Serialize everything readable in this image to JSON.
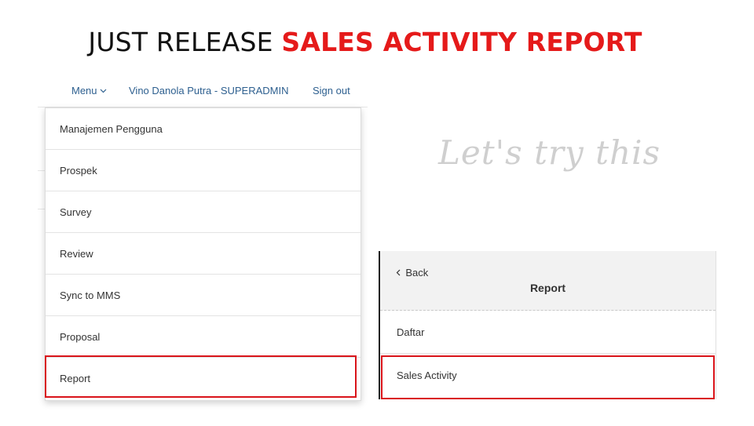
{
  "title": {
    "plain": "JUST RELEASE ",
    "accent": "SALES ACTIVITY REPORT"
  },
  "topnav": {
    "menu_label": "Menu",
    "user_label": "Vino Danola Putra - SUPERADMIN",
    "signout_label": "Sign out"
  },
  "dropdown": {
    "items": [
      {
        "label": "Manajemen Pengguna"
      },
      {
        "label": "Prospek"
      },
      {
        "label": "Survey"
      },
      {
        "label": "Review"
      },
      {
        "label": "Sync to MMS"
      },
      {
        "label": "Proposal"
      },
      {
        "label": "Report"
      }
    ]
  },
  "script_text": "Let's try this",
  "submenu": {
    "back_label": "Back",
    "heading": "Report",
    "items": [
      {
        "label": "Daftar"
      },
      {
        "label": "Sales Activity"
      }
    ]
  },
  "colors": {
    "accent": "#e51a1a",
    "link": "#2d5f8f",
    "highlight": "#d9141a"
  },
  "icons": {
    "menu_chevron": "chevron-down-icon",
    "back_chevron": "chevron-left-icon"
  }
}
